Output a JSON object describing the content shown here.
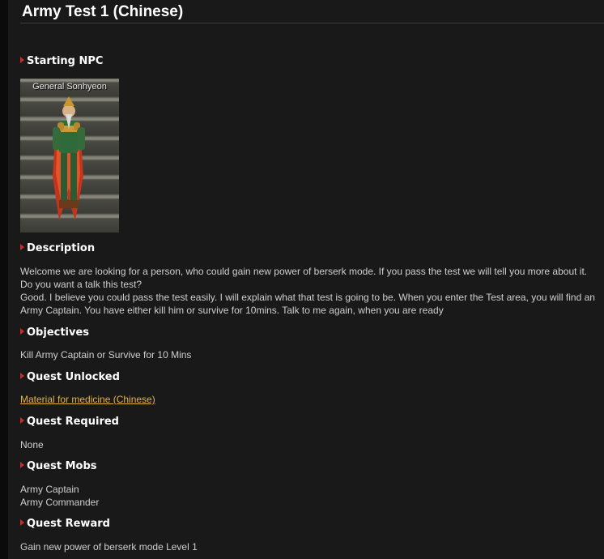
{
  "page": {
    "title": "Army Test 1 (Chinese)"
  },
  "npc": {
    "section_label": "Starting NPC",
    "name": "General Sonhyeon"
  },
  "description": {
    "section_label": "Description",
    "paragraph1": "Welcome we are looking for a person, who could gain new power of berserk mode. If you pass the test we will tell you more about it. Do you want a talk this test?",
    "paragraph2": "Good. I believe you could pass the test easily. I will explain what that test is going to be. When you enter the Test area, you will find an Army Captain. You have either kill him or survive for 10mins. Talk to me again, when you are ready"
  },
  "objectives": {
    "section_label": "Objectives",
    "text": "Kill Army Captain or Survive for 10 Mins"
  },
  "quest_unlocked": {
    "section_label": "Quest Unlocked",
    "link_text": "Material for medicine (Chinese)"
  },
  "quest_required": {
    "section_label": "Quest Required",
    "text": "None"
  },
  "quest_mobs": {
    "section_label": "Quest Mobs",
    "items": [
      "Army Captain",
      "Army Commander"
    ]
  },
  "quest_reward": {
    "section_label": "Quest Reward",
    "text": "Gain new power of berserk mode Level 1"
  },
  "colors": {
    "background": "#191919",
    "heading": "#ffffff",
    "body_text": "#cfcfcf",
    "link": "#e6b43a",
    "section_arrow": "#cc2b2b"
  }
}
